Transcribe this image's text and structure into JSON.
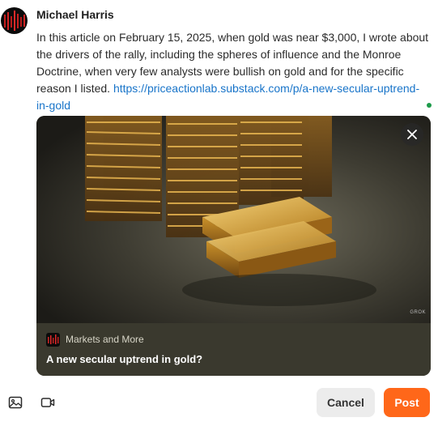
{
  "author": {
    "name": "Michael Harris"
  },
  "post": {
    "text": "In this article on February 15, 2025, when gold was near $3,000, I wrote about the drivers of the rally, including the spheres of influence and the Monroe Doctrine, when very few analysts were bullish on gold and for the specific reason I listed. ",
    "link": "https://priceactionlab.substack.com/p/a-new-secular-uptrend-in-gold"
  },
  "link_card": {
    "publication": "Markets and More",
    "title": "A new secular uptrend in gold?",
    "image_watermark": "GROK"
  },
  "toolbar": {
    "image_icon": "image-icon",
    "video_icon": "video-icon"
  },
  "actions": {
    "cancel_label": "Cancel",
    "post_label": "Post"
  },
  "colors": {
    "accent": "#ff6719",
    "link": "#1874c9",
    "online": "#1d9b4a"
  }
}
